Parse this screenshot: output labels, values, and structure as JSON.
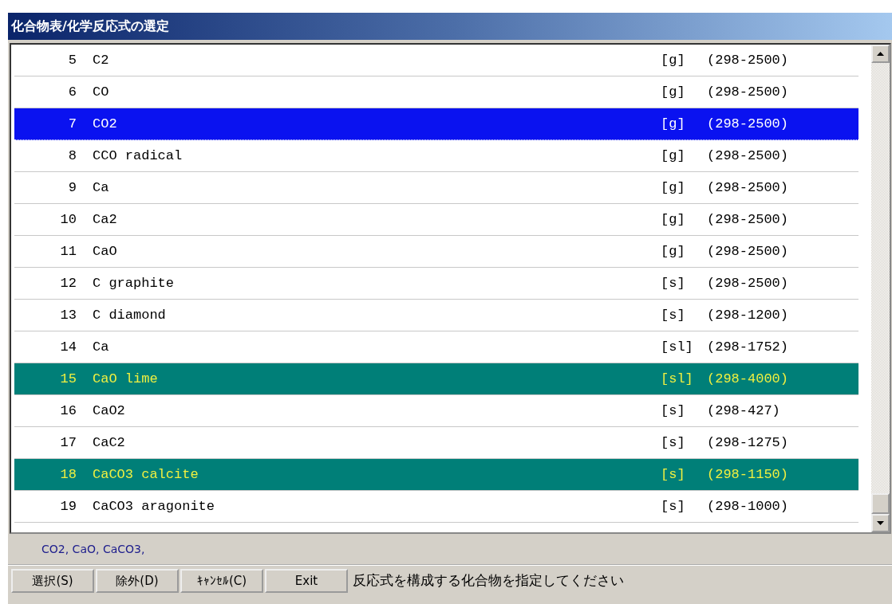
{
  "window": {
    "title": "化合物表/化学反応式の選定"
  },
  "list": {
    "rows": [
      {
        "number": "5",
        "name": "C2",
        "phase": "[g]",
        "range": "(298-2500)",
        "selected": false,
        "focused": false
      },
      {
        "number": "6",
        "name": "CO",
        "phase": "[g]",
        "range": "(298-2500)",
        "selected": false,
        "focused": false
      },
      {
        "number": "7",
        "name": "CO2",
        "phase": "[g]",
        "range": "(298-2500)",
        "selected": true,
        "focused": true
      },
      {
        "number": "8",
        "name": "CCO radical",
        "phase": "[g]",
        "range": "(298-2500)",
        "selected": false,
        "focused": false
      },
      {
        "number": "9",
        "name": "Ca",
        "phase": "[g]",
        "range": "(298-2500)",
        "selected": false,
        "focused": false
      },
      {
        "number": "10",
        "name": "Ca2",
        "phase": "[g]",
        "range": "(298-2500)",
        "selected": false,
        "focused": false
      },
      {
        "number": "11",
        "name": "CaO",
        "phase": "[g]",
        "range": "(298-2500)",
        "selected": false,
        "focused": false
      },
      {
        "number": "12",
        "name": "C graphite",
        "phase": "[s]",
        "range": "(298-2500)",
        "selected": false,
        "focused": false
      },
      {
        "number": "13",
        "name": "C diamond",
        "phase": "[s]",
        "range": "(298-1200)",
        "selected": false,
        "focused": false
      },
      {
        "number": "14",
        "name": "Ca",
        "phase": "[sl]",
        "range": "(298-1752)",
        "selected": false,
        "focused": false
      },
      {
        "number": "15",
        "name": "CaO lime",
        "phase": "[sl]",
        "range": "(298-4000)",
        "selected": true,
        "focused": false
      },
      {
        "number": "16",
        "name": "CaO2",
        "phase": "[s]",
        "range": "(298-427)",
        "selected": false,
        "focused": false
      },
      {
        "number": "17",
        "name": "CaC2",
        "phase": "[s]",
        "range": "(298-1275)",
        "selected": false,
        "focused": false
      },
      {
        "number": "18",
        "name": "CaCO3 calcite",
        "phase": "[s]",
        "range": "(298-1150)",
        "selected": true,
        "focused": false
      },
      {
        "number": "19",
        "name": "CaCO3 aragonite",
        "phase": "[s]",
        "range": "(298-1000)",
        "selected": false,
        "focused": false
      }
    ]
  },
  "selection_text": "CO2, CaO, CaCO3,",
  "buttons": [
    "選択(S)",
    "除外(D)",
    "ｷｬﾝｾﾙ(C)",
    "Exit"
  ],
  "status_message": "反応式を構成する化合物を指定してください"
}
